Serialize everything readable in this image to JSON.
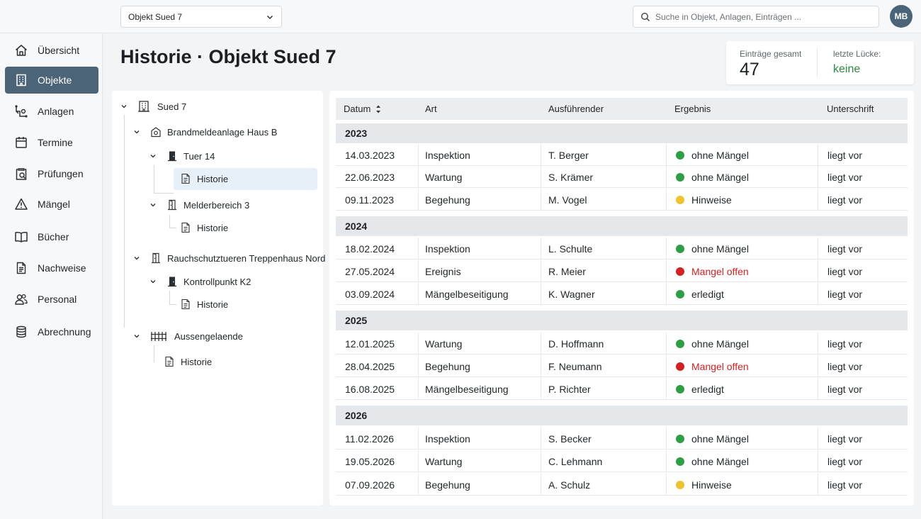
{
  "topbar": {
    "object_select": "Objekt Sued 7",
    "search_placeholder": "Suche in Objekt, Anlagen, Einträgen ...",
    "avatar": "MB"
  },
  "nav": [
    {
      "label": "Übersicht",
      "icon": "home-icon"
    },
    {
      "label": "Objekte",
      "icon": "building-icon",
      "active": true
    },
    {
      "label": "Anlagen",
      "icon": "plant-icon"
    },
    {
      "label": "Termine",
      "icon": "calendar-icon"
    },
    {
      "label": "Prüfungen",
      "icon": "inspection-icon"
    },
    {
      "label": "Mängel",
      "icon": "warning-icon"
    },
    {
      "label": "Bücher",
      "icon": "book-icon"
    },
    {
      "label": "Nachweise",
      "icon": "document-icon"
    },
    {
      "label": "Personal",
      "icon": "people-icon"
    },
    {
      "label": "Abrechnung",
      "icon": "coins-icon"
    }
  ],
  "page": {
    "title": "Historie · Objekt Sued 7"
  },
  "stats": {
    "entries_label": "Einträge gesamt",
    "entries_value": "47",
    "gap_label": "letzte Lücke:",
    "gap_value": "keine"
  },
  "tree": {
    "root": "Sued 7",
    "anlage1": "Brandmeldeanlage Haus B",
    "tuer": "Tuer 14",
    "historie1": "Historie",
    "melder": "Melderbereich 3",
    "historie2": "Historie",
    "anlage2": "Rauchschutztueren Treppenhaus Nord",
    "kontroll": "Kontrollpunkt K2",
    "historie3": "Historie",
    "aussen": "Aussengelaende",
    "historie4": "Historie"
  },
  "table": {
    "headers": {
      "datum": "Datum",
      "art": "Art",
      "ausfuehrender": "Ausführender",
      "ergebnis": "Ergebnis",
      "unterschrift": "Unterschrift"
    },
    "status_colors": {
      "ok": "#2e9e45",
      "hint": "#f2c12e",
      "open": "#d42020"
    },
    "groups": [
      {
        "year": "2023",
        "rows": [
          {
            "datum": "14.03.2023",
            "art": "Inspektion",
            "person": "T. Berger",
            "ergebnis": "ohne Mängel",
            "status": "ok",
            "unterschrift": "liegt vor"
          },
          {
            "datum": "22.06.2023",
            "art": "Wartung",
            "person": "S. Krämer",
            "ergebnis": "ohne Mängel",
            "status": "ok",
            "unterschrift": "liegt vor"
          },
          {
            "datum": "09.11.2023",
            "art": "Begehung",
            "person": "M. Vogel",
            "ergebnis": "Hinweise",
            "status": "hint",
            "unterschrift": "liegt vor"
          }
        ]
      },
      {
        "year": "2024",
        "rows": [
          {
            "datum": "18.02.2024",
            "art": "Inspektion",
            "person": "L. Schulte",
            "ergebnis": "ohne Mängel",
            "status": "ok",
            "unterschrift": "liegt vor"
          },
          {
            "datum": "27.05.2024",
            "art": "Ereignis",
            "person": "R. Meier",
            "ergebnis": "Mangel offen",
            "status": "open",
            "unterschrift": "liegt vor"
          },
          {
            "datum": "03.09.2024",
            "art": "Mängelbeseitigung",
            "person": "K. Wagner",
            "ergebnis": "erledigt",
            "status": "ok",
            "unterschrift": "liegt vor"
          }
        ]
      },
      {
        "year": "2025",
        "rows": [
          {
            "datum": "12.01.2025",
            "art": "Wartung",
            "person": "D. Hoffmann",
            "ergebnis": "ohne Mängel",
            "status": "ok",
            "unterschrift": "liegt vor"
          },
          {
            "datum": "28.04.2025",
            "art": "Begehung",
            "person": "F. Neumann",
            "ergebnis": "Mangel offen",
            "status": "open",
            "unterschrift": "liegt vor"
          },
          {
            "datum": "16.08.2025",
            "art": "Mängelbeseitigung",
            "person": "P. Richter",
            "ergebnis": "erledigt",
            "status": "ok",
            "unterschrift": "liegt vor"
          }
        ]
      },
      {
        "year": "2026",
        "rows": [
          {
            "datum": "11.02.2026",
            "art": "Inspektion",
            "person": "S. Becker",
            "ergebnis": "ohne Mängel",
            "status": "ok",
            "unterschrift": "liegt vor"
          },
          {
            "datum": "19.05.2026",
            "art": "Wartung",
            "person": "C. Lehmann",
            "ergebnis": "ohne Mängel",
            "status": "ok",
            "unterschrift": "liegt vor"
          },
          {
            "datum": "07.09.2026",
            "art": "Begehung",
            "person": "A. Schulz",
            "ergebnis": "Hinweise",
            "status": "hint",
            "unterschrift": "liegt vor"
          }
        ]
      }
    ]
  }
}
